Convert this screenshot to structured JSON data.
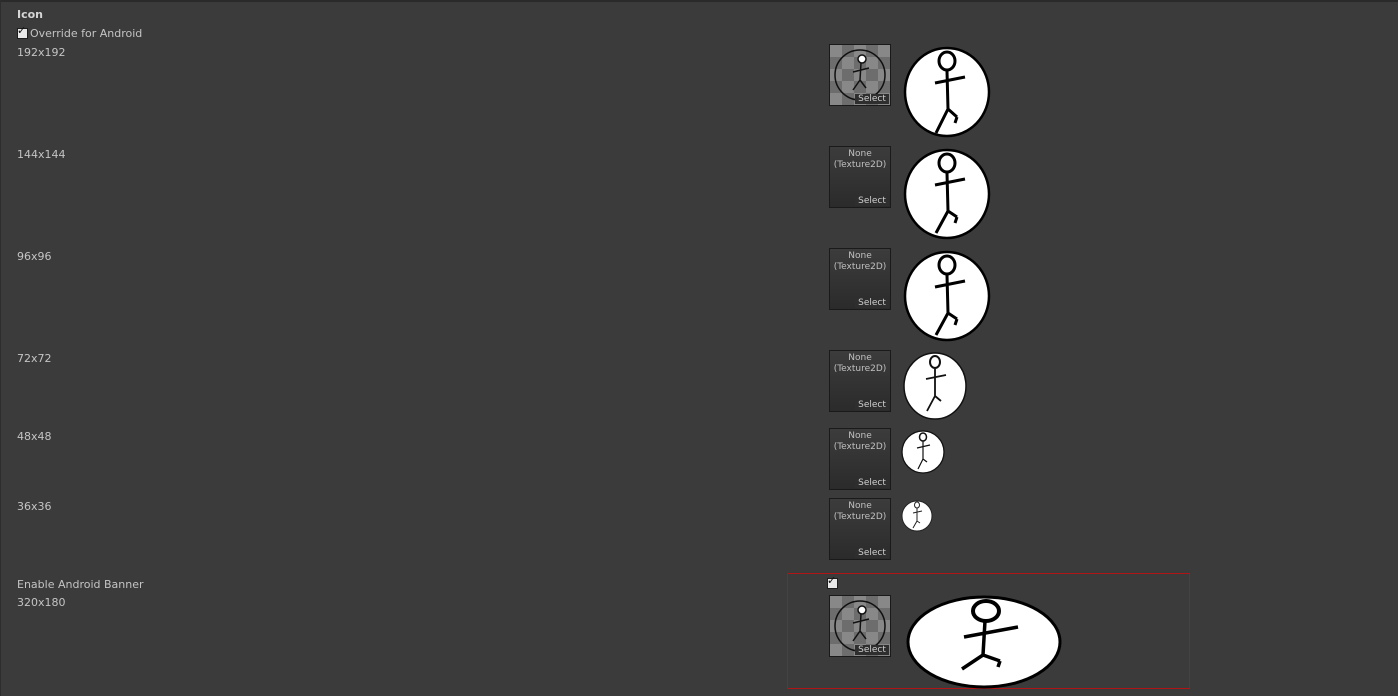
{
  "section": {
    "title": "Icon"
  },
  "override": {
    "label": "Override for Android",
    "checked": true
  },
  "icon_rows": [
    {
      "size": "192x192",
      "texture": "assigned",
      "select_label": "Select"
    },
    {
      "size": "144x144",
      "texture": "None\n(Texture2D)",
      "select_label": "Select"
    },
    {
      "size": "96x96",
      "texture": "None\n(Texture2D)",
      "select_label": "Select"
    },
    {
      "size": "72x72",
      "texture": "None\n(Texture2D)",
      "select_label": "Select"
    },
    {
      "size": "48x48",
      "texture": "None\n(Texture2D)",
      "select_label": "Select"
    },
    {
      "size": "36x36",
      "texture": "None\n(Texture2D)",
      "select_label": "Select"
    }
  ],
  "banner": {
    "enable_label": "Enable Android Banner",
    "enabled": true,
    "size": "320x180",
    "select_label": "Select"
  },
  "colors": {
    "background": "#3b3b3b",
    "highlight_border": "#b01414"
  },
  "icons": {
    "preview": "stick-figure-icon",
    "checkbox": "checkmark-icon"
  }
}
